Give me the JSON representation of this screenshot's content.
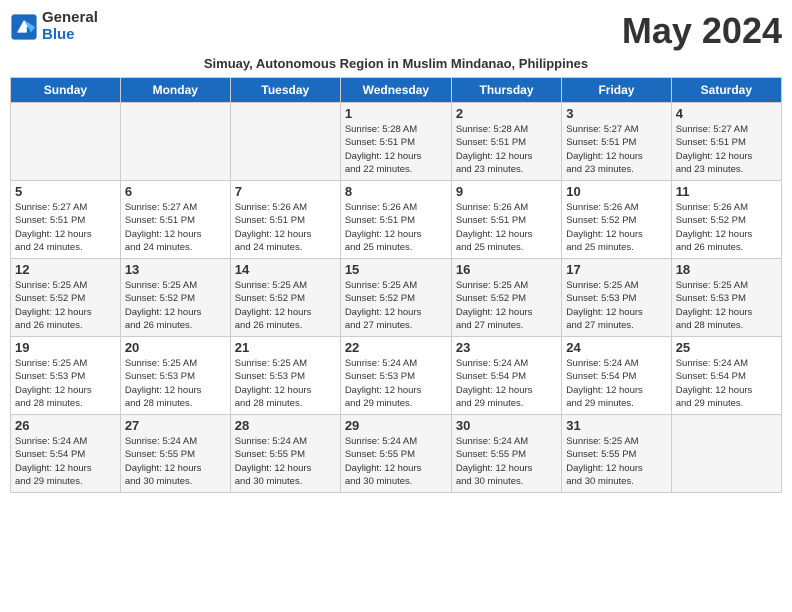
{
  "logo": {
    "general": "General",
    "blue": "Blue"
  },
  "title": "May 2024",
  "subtitle": "Simuay, Autonomous Region in Muslim Mindanao, Philippines",
  "headers": [
    "Sunday",
    "Monday",
    "Tuesday",
    "Wednesday",
    "Thursday",
    "Friday",
    "Saturday"
  ],
  "weeks": [
    [
      {
        "day": "",
        "info": ""
      },
      {
        "day": "",
        "info": ""
      },
      {
        "day": "",
        "info": ""
      },
      {
        "day": "1",
        "info": "Sunrise: 5:28 AM\nSunset: 5:51 PM\nDaylight: 12 hours\nand 22 minutes."
      },
      {
        "day": "2",
        "info": "Sunrise: 5:28 AM\nSunset: 5:51 PM\nDaylight: 12 hours\nand 23 minutes."
      },
      {
        "day": "3",
        "info": "Sunrise: 5:27 AM\nSunset: 5:51 PM\nDaylight: 12 hours\nand 23 minutes."
      },
      {
        "day": "4",
        "info": "Sunrise: 5:27 AM\nSunset: 5:51 PM\nDaylight: 12 hours\nand 23 minutes."
      }
    ],
    [
      {
        "day": "5",
        "info": "Sunrise: 5:27 AM\nSunset: 5:51 PM\nDaylight: 12 hours\nand 24 minutes."
      },
      {
        "day": "6",
        "info": "Sunrise: 5:27 AM\nSunset: 5:51 PM\nDaylight: 12 hours\nand 24 minutes."
      },
      {
        "day": "7",
        "info": "Sunrise: 5:26 AM\nSunset: 5:51 PM\nDaylight: 12 hours\nand 24 minutes."
      },
      {
        "day": "8",
        "info": "Sunrise: 5:26 AM\nSunset: 5:51 PM\nDaylight: 12 hours\nand 25 minutes."
      },
      {
        "day": "9",
        "info": "Sunrise: 5:26 AM\nSunset: 5:51 PM\nDaylight: 12 hours\nand 25 minutes."
      },
      {
        "day": "10",
        "info": "Sunrise: 5:26 AM\nSunset: 5:52 PM\nDaylight: 12 hours\nand 25 minutes."
      },
      {
        "day": "11",
        "info": "Sunrise: 5:26 AM\nSunset: 5:52 PM\nDaylight: 12 hours\nand 26 minutes."
      }
    ],
    [
      {
        "day": "12",
        "info": "Sunrise: 5:25 AM\nSunset: 5:52 PM\nDaylight: 12 hours\nand 26 minutes."
      },
      {
        "day": "13",
        "info": "Sunrise: 5:25 AM\nSunset: 5:52 PM\nDaylight: 12 hours\nand 26 minutes."
      },
      {
        "day": "14",
        "info": "Sunrise: 5:25 AM\nSunset: 5:52 PM\nDaylight: 12 hours\nand 26 minutes."
      },
      {
        "day": "15",
        "info": "Sunrise: 5:25 AM\nSunset: 5:52 PM\nDaylight: 12 hours\nand 27 minutes."
      },
      {
        "day": "16",
        "info": "Sunrise: 5:25 AM\nSunset: 5:52 PM\nDaylight: 12 hours\nand 27 minutes."
      },
      {
        "day": "17",
        "info": "Sunrise: 5:25 AM\nSunset: 5:53 PM\nDaylight: 12 hours\nand 27 minutes."
      },
      {
        "day": "18",
        "info": "Sunrise: 5:25 AM\nSunset: 5:53 PM\nDaylight: 12 hours\nand 28 minutes."
      }
    ],
    [
      {
        "day": "19",
        "info": "Sunrise: 5:25 AM\nSunset: 5:53 PM\nDaylight: 12 hours\nand 28 minutes."
      },
      {
        "day": "20",
        "info": "Sunrise: 5:25 AM\nSunset: 5:53 PM\nDaylight: 12 hours\nand 28 minutes."
      },
      {
        "day": "21",
        "info": "Sunrise: 5:25 AM\nSunset: 5:53 PM\nDaylight: 12 hours\nand 28 minutes."
      },
      {
        "day": "22",
        "info": "Sunrise: 5:24 AM\nSunset: 5:53 PM\nDaylight: 12 hours\nand 29 minutes."
      },
      {
        "day": "23",
        "info": "Sunrise: 5:24 AM\nSunset: 5:54 PM\nDaylight: 12 hours\nand 29 minutes."
      },
      {
        "day": "24",
        "info": "Sunrise: 5:24 AM\nSunset: 5:54 PM\nDaylight: 12 hours\nand 29 minutes."
      },
      {
        "day": "25",
        "info": "Sunrise: 5:24 AM\nSunset: 5:54 PM\nDaylight: 12 hours\nand 29 minutes."
      }
    ],
    [
      {
        "day": "26",
        "info": "Sunrise: 5:24 AM\nSunset: 5:54 PM\nDaylight: 12 hours\nand 29 minutes."
      },
      {
        "day": "27",
        "info": "Sunrise: 5:24 AM\nSunset: 5:55 PM\nDaylight: 12 hours\nand 30 minutes."
      },
      {
        "day": "28",
        "info": "Sunrise: 5:24 AM\nSunset: 5:55 PM\nDaylight: 12 hours\nand 30 minutes."
      },
      {
        "day": "29",
        "info": "Sunrise: 5:24 AM\nSunset: 5:55 PM\nDaylight: 12 hours\nand 30 minutes."
      },
      {
        "day": "30",
        "info": "Sunrise: 5:24 AM\nSunset: 5:55 PM\nDaylight: 12 hours\nand 30 minutes."
      },
      {
        "day": "31",
        "info": "Sunrise: 5:25 AM\nSunset: 5:55 PM\nDaylight: 12 hours\nand 30 minutes."
      },
      {
        "day": "",
        "info": ""
      }
    ]
  ]
}
